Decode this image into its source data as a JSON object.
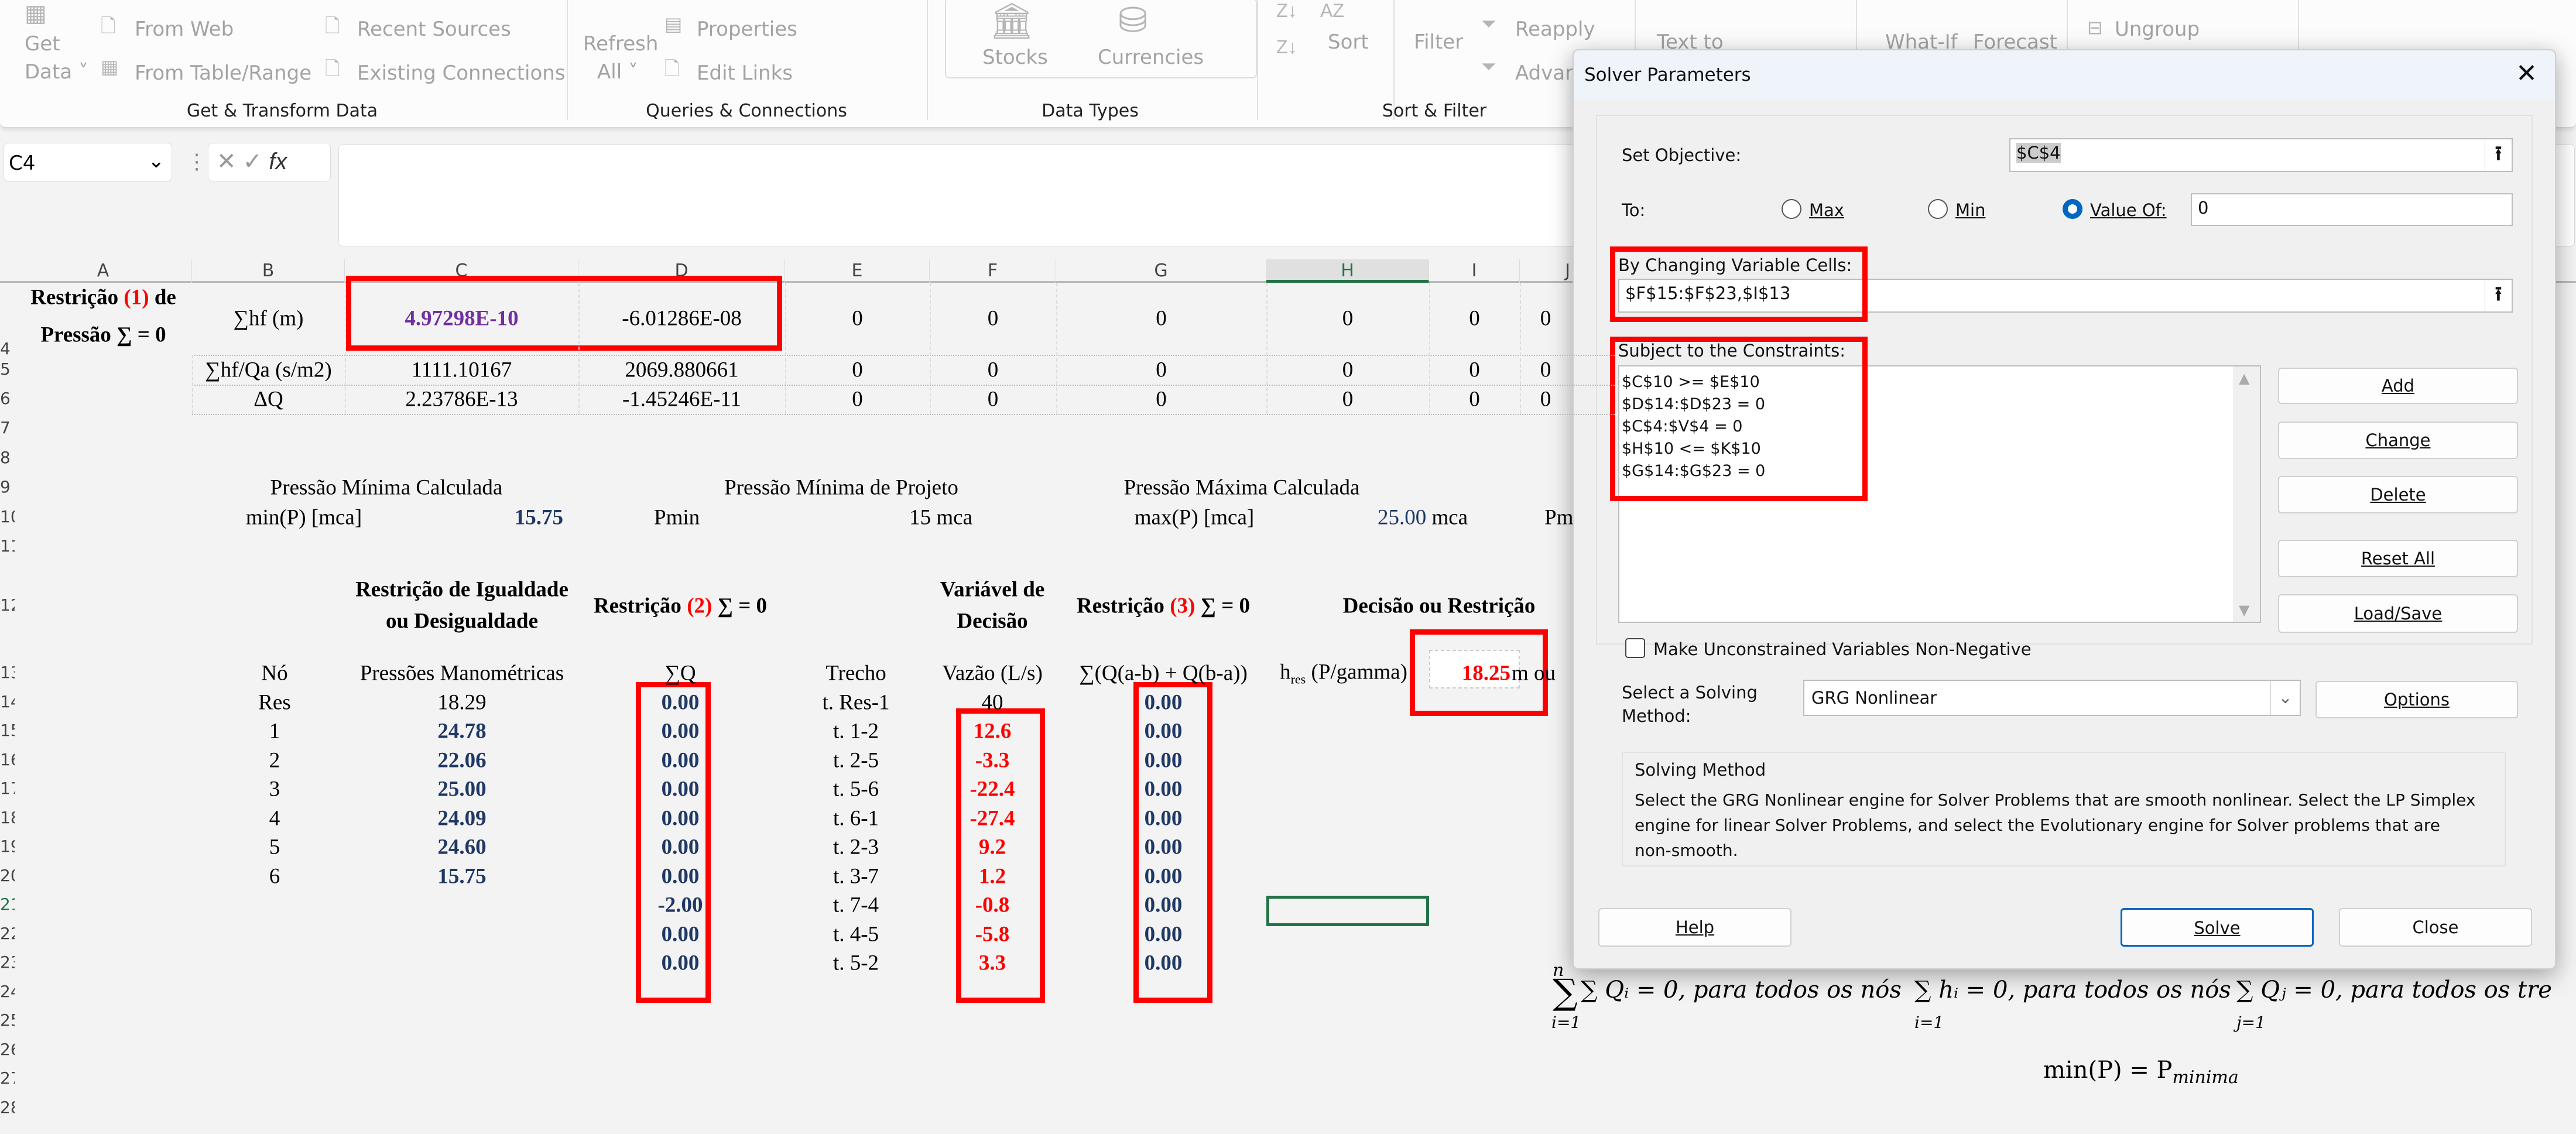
{
  "ribbon": {
    "get_data": [
      "Get",
      "Data ˅"
    ],
    "from_web": "From Web",
    "from_table": "From Table/Range",
    "recent_sources": "Recent Sources",
    "existing_connections": "Existing Connections",
    "refresh_all": [
      "Refresh",
      "All ˅"
    ],
    "properties": "Properties",
    "edit_links": "Edit Links",
    "stocks": "Stocks",
    "currencies": "Currencies",
    "sort": "Sort",
    "filter": "Filter",
    "reapply": "Reapply",
    "advanced": "Advan",
    "text_to": "Text to",
    "what_if": "What-If",
    "forecast": "Forecast",
    "ungroup": "Ungroup",
    "groups": [
      "Get & Transform Data",
      "Queries & Connections",
      "Data Types",
      "Sort & Filter"
    ]
  },
  "namebox": "C4",
  "fx": "fx",
  "columns": [
    "A",
    "B",
    "C",
    "D",
    "E",
    "F",
    "G",
    "H",
    "I",
    "J"
  ],
  "rows": [
    "4",
    "5",
    "6",
    "7",
    "8",
    "9",
    "10",
    "11",
    "12",
    "13",
    "14",
    "15",
    "16",
    "17",
    "18",
    "19",
    "20",
    "21",
    "22",
    "23",
    "24",
    "25",
    "26",
    "27",
    "28"
  ],
  "sheet": {
    "row4": {
      "a1": "Restrição ",
      "a1r": "(1)",
      "a1e": " de",
      "a2": "Pressão ∑ = 0",
      "b": "∑hf (m)",
      "c": "4.97298E-10",
      "d": "-6.01286E-08",
      "rest": [
        "0",
        "0",
        "0",
        "0",
        "0",
        "0"
      ]
    },
    "row5": {
      "b": "∑hf/Qa (s/m2)",
      "c": "1111.10167",
      "d": "2069.880661",
      "rest": [
        "0",
        "0",
        "0",
        "0",
        "0",
        "0"
      ]
    },
    "row6": {
      "b": "ΔQ",
      "c": "2.23786E-13",
      "d": "-1.45246E-11",
      "rest": [
        "0",
        "0",
        "0",
        "0",
        "0",
        "0"
      ]
    },
    "row9": [
      "Pressão Mínima Calculada",
      "Pressão Mínima de Projeto",
      "Pressão Máxima Calculada"
    ],
    "row10": {
      "minp": "min(P) [mca]",
      "minv": "15.75",
      "pmin": "Pmin",
      "pminv": "15 mca",
      "maxp": "max(P) [mca]",
      "maxv": "25.00",
      "maxu": " mca",
      "pm": "Pm"
    },
    "row12": {
      "c1": "Restrição de Igualdade",
      "c2": "ou Desigualdade",
      "d1": "Restrição ",
      "d2": "(2)",
      "d3": " ∑ = 0",
      "f1": "Variável de",
      "f2": "Decisão",
      "g1": "Restrição ",
      "g2": "(3)",
      "g3": " ∑ = 0",
      "h": "Decisão ou Restrição"
    },
    "row13": {
      "no": "Nó",
      "press": "Pressões Manométricas",
      "sq": "∑Q",
      "trecho": "Trecho",
      "vazao": "Vazão (L/s)",
      "sum": "∑(Q(a-b) + Q(b-a))",
      "h": "h",
      "hsub": "res",
      "hrest": " (P/gamma)",
      "i": "18.25",
      "iu": " m ou"
    },
    "nodes": [
      "Res",
      "1",
      "2",
      "3",
      "4",
      "5",
      "6"
    ],
    "pressures": [
      "18.29",
      "24.78",
      "22.06",
      "25.00",
      "24.09",
      "24.60",
      "15.75"
    ],
    "sumq": [
      "0.00",
      "0.00",
      "0.00",
      "0.00",
      "0.00",
      "0.00",
      "0.00",
      "-2.00",
      "0.00",
      "0.00"
    ],
    "trechos": [
      "t. Res-1",
      "t. 1-2",
      "t. 2-5",
      "t. 5-6",
      "t. 6-1",
      "t. 2-3",
      "t. 3-7",
      "t. 7-4",
      "t. 4-5",
      "t. 5-2"
    ],
    "vazoes": [
      "40",
      "12.6",
      "-3.3",
      "-22.4",
      "-27.4",
      "9.2",
      "1.2",
      "-0.8",
      "-5.8",
      "3.3"
    ],
    "sumg": [
      "0.00",
      "0.00",
      "0.00",
      "0.00",
      "0.00",
      "0.00",
      "0.00",
      "0.00",
      "0.00",
      "0.00"
    ],
    "formulas": [
      "∑ Qᵢ = 0, para todos os nós",
      "∑ hᵢ = 0, para todos os nós",
      "∑ Qⱼ = 0, para todos os tre",
      "min(P) = P"
    ],
    "formula_sub": "minima",
    "sum_lower": [
      "i=1",
      "i=1",
      "j=1"
    ],
    "sum_upper": "n"
  },
  "dialog": {
    "title": "Solver Parameters",
    "set_objective_label": "Set Objective:",
    "objective": "$C$4",
    "to_label": "To:",
    "max": "Max",
    "min": "Min",
    "value_of": "Value Of:",
    "value": "0",
    "changing_label": "By Changing Variable Cells:",
    "changing": "$F$15:$F$23,$I$13",
    "constraints_label": "Subject to the Constraints:",
    "constraints": [
      "$C$10 >= $E$10",
      "$D$14:$D$23 = 0",
      "$C$4:$V$4 = 0",
      "$H$10 <= $K$10",
      "$G$14:$G$23 = 0"
    ],
    "buttons": {
      "add": "Add",
      "change": "Change",
      "delete": "Delete",
      "reset": "Reset All",
      "load": "Load/Save",
      "options": "Options",
      "help": "Help",
      "solve": "Solve",
      "close": "Close"
    },
    "nonneg": "Make Unconstrained Variables Non-Negative",
    "nonneg_checked": false,
    "method_label": [
      "Select a Solving",
      "Method:"
    ],
    "method": "GRG Nonlinear",
    "method_box_title": "Solving Method",
    "method_desc": [
      "Select the GRG Nonlinear engine for Solver Problems that are smooth nonlinear. Select the LP Simplex",
      "engine for linear Solver Problems, and select the Evolutionary engine for Solver problems that are",
      "non-smooth."
    ],
    "selected_radio": "value_of"
  },
  "colors": {
    "highlight": "#ff0000",
    "value_navy": "#1f3864",
    "purple": "#7030a0",
    "accent": "#0067c0",
    "selection": "#217346"
  }
}
